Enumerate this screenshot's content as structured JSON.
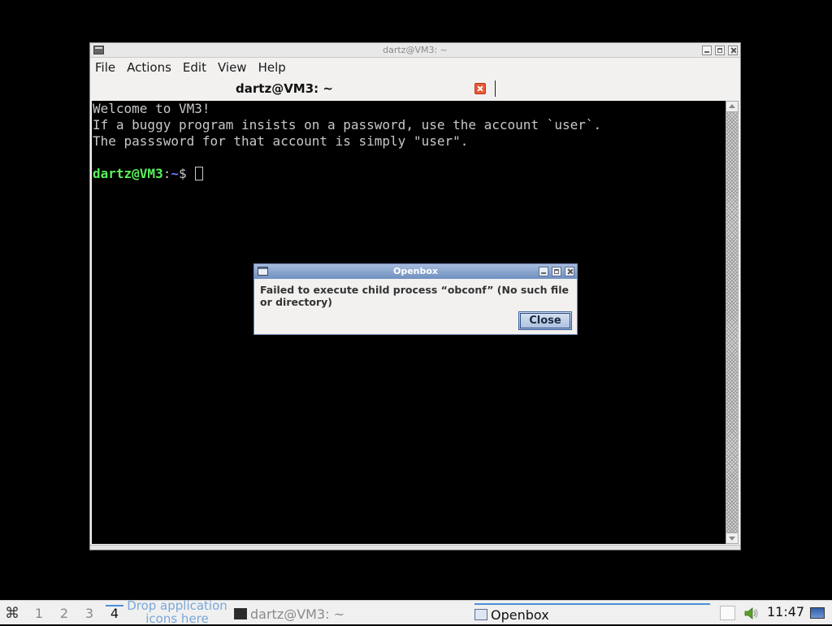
{
  "terminal_window": {
    "title": "dartz@VM3: ~",
    "menu": [
      "File",
      "Actions",
      "Edit",
      "View",
      "Help"
    ],
    "tab_label": "dartz@VM3: ~",
    "lines": [
      "Welcome to VM3!",
      "If a buggy program insists on a password, use the account `user`.",
      "The passsword for that account is simply \"user\"."
    ],
    "prompt": {
      "user_host": "dartz@VM3",
      "separator": ":",
      "path": "~",
      "symbol": "$ "
    },
    "colors": {
      "prompt_user": "#5af05a",
      "prompt_path": "#6b77ff",
      "text": "#c8c8c8",
      "background": "#000000"
    }
  },
  "dialog": {
    "title": "Openbox",
    "message": "Failed to execute child process “obconf” (No such file or directory)",
    "close_label": "Close"
  },
  "taskbar": {
    "workspaces": [
      "1",
      "2",
      "3",
      "4"
    ],
    "active_workspace": "4",
    "drop_hint": "Drop application icons here",
    "tasks": [
      {
        "label": "dartz@VM3: ~",
        "icon": "terminal-icon"
      },
      {
        "label": "Openbox",
        "icon": "window-icon"
      }
    ],
    "clock": "11:47",
    "accent": "#4a8fd8"
  }
}
